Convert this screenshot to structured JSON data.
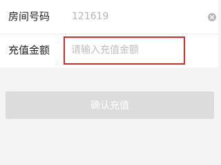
{
  "form": {
    "room_number": {
      "label": "房间号码",
      "value": "121619",
      "clear_icon": "clear-circle-icon"
    },
    "recharge_amount": {
      "label": "充值金额",
      "value": "",
      "placeholder": "请输入充值金额"
    }
  },
  "confirm_button": {
    "label": "确认充值"
  },
  "colors": {
    "highlight_border": "#d42a2a",
    "button_disabled_bg": "#dcdcdc",
    "page_bg": "#f4f4f4"
  }
}
